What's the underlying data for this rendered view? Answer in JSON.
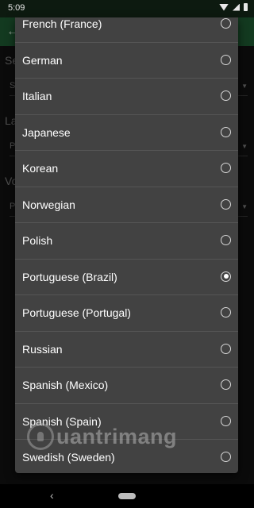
{
  "status_bar": {
    "time": "5:09"
  },
  "background": {
    "label_1": "Se",
    "value_1": "S",
    "label_2": "La",
    "value_2": "P",
    "label_3": "Vo",
    "value_3": "P"
  },
  "dialog": {
    "languages": [
      {
        "label": "French (France)",
        "selected": false
      },
      {
        "label": "German",
        "selected": false
      },
      {
        "label": "Italian",
        "selected": false
      },
      {
        "label": "Japanese",
        "selected": false
      },
      {
        "label": "Korean",
        "selected": false
      },
      {
        "label": "Norwegian",
        "selected": false
      },
      {
        "label": "Polish",
        "selected": false
      },
      {
        "label": "Portuguese (Brazil)",
        "selected": true
      },
      {
        "label": "Portuguese (Portugal)",
        "selected": false
      },
      {
        "label": "Russian",
        "selected": false
      },
      {
        "label": "Spanish (Mexico)",
        "selected": false
      },
      {
        "label": "Spanish (Spain)",
        "selected": false
      },
      {
        "label": "Swedish (Sweden)",
        "selected": false
      }
    ]
  },
  "watermark": {
    "text": "uantrimang"
  }
}
